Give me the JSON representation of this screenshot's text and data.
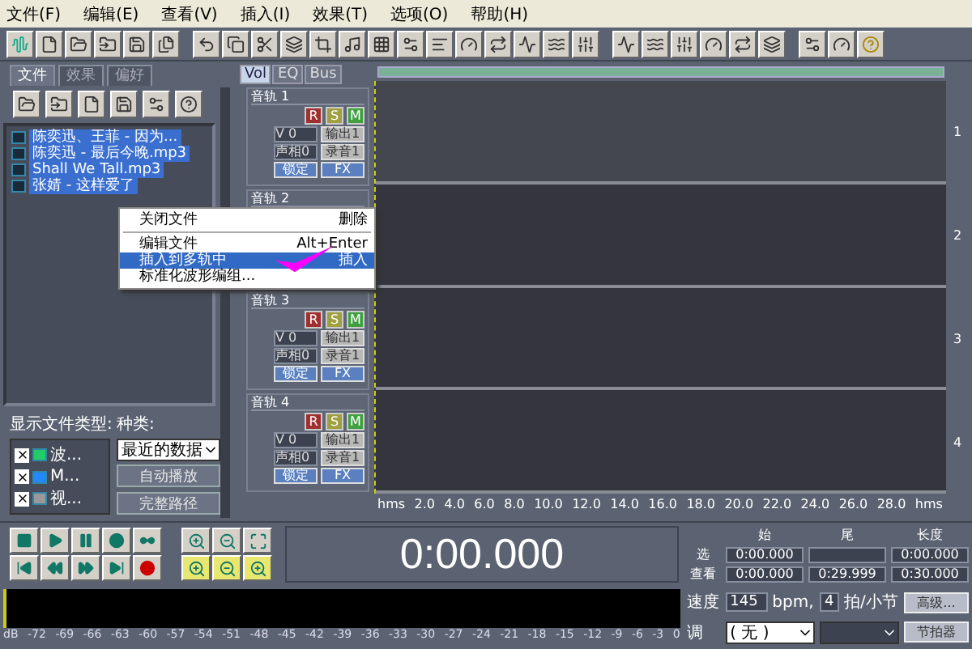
{
  "menu": [
    "文件(F)",
    "编辑(E)",
    "查看(V)",
    "插入(I)",
    "效果(T)",
    "选项(O)",
    "帮助(H)"
  ],
  "left_panel": {
    "tabs": [
      {
        "label": "文件",
        "selected": true
      },
      {
        "label": "效果",
        "selected": false
      },
      {
        "label": "偏好",
        "selected": false
      }
    ],
    "files": [
      {
        "name": "陈奕迅、王菲 - 因为...",
        "selected": true
      },
      {
        "name": "陈奕迅 - 最后今晚.mp3",
        "selected": true
      },
      {
        "name": "Shall We Tall.mp3",
        "selected": true
      },
      {
        "name": "张婧 - 这样爱了",
        "selected": true
      }
    ],
    "filter_label": "显示文件类型:",
    "sort_label": "种类:",
    "file_types": [
      {
        "label": "波...",
        "checked": true,
        "kind": "wave"
      },
      {
        "label": "M...",
        "checked": true,
        "kind": "midi"
      },
      {
        "label": "视...",
        "checked": true,
        "kind": "video"
      }
    ],
    "sort_select": "最近的数据",
    "buttons": [
      "自动播放",
      "完整路径"
    ]
  },
  "mixer_tabs": [
    {
      "label": "Vol",
      "selected": true
    },
    {
      "label": "EQ",
      "selected": false
    },
    {
      "label": "Bus",
      "selected": false
    }
  ],
  "tracks": [
    {
      "name": "音轨 1",
      "rsm": [
        "R",
        "S",
        "M"
      ],
      "volume": "V 0",
      "output": "输出1",
      "pan": "声相0",
      "input": "录音1",
      "lock": "锁定",
      "fx": "FX"
    },
    {
      "name": "音轨 2"
    },
    {
      "name": "音轨 3",
      "rsm": [
        "R",
        "S",
        "M"
      ],
      "volume": "V 0",
      "output": "输出1",
      "pan": "声相0",
      "input": "录音1",
      "lock": "锁定",
      "fx": "FX"
    },
    {
      "name": "音轨 4",
      "rsm": [
        "R",
        "S",
        "M"
      ],
      "volume": "V 0",
      "output": "输出1",
      "pan": "声相0",
      "input": "录音1",
      "lock": "锁定",
      "fx": "FX"
    }
  ],
  "lane_numbers": [
    "1",
    "2",
    "3",
    "4"
  ],
  "ruler": [
    "hms",
    "2.0",
    "4.0",
    "6.0",
    "8.0",
    "10.0",
    "12.0",
    "14.0",
    "16.0",
    "18.0",
    "20.0",
    "22.0",
    "24.0",
    "26.0",
    "28.0",
    "hms"
  ],
  "context_menu": [
    {
      "kind": "item",
      "label": "关闭文件",
      "shortcut": "删除",
      "selected": false
    },
    {
      "kind": "separator"
    },
    {
      "kind": "item",
      "label": "编辑文件",
      "shortcut": "Alt+Enter",
      "selected": false
    },
    {
      "kind": "item",
      "label": "插入到多轨中",
      "shortcut": "插入",
      "selected": true
    },
    {
      "kind": "item",
      "label": "标准化波形编组...",
      "selected": false
    }
  ],
  "time_display": "0:00.000",
  "selection": {
    "headers": [
      "始",
      "尾",
      "长度"
    ],
    "rows": [
      {
        "label": "选",
        "start": "0:00.000",
        "length": "0:00.000"
      },
      {
        "label": "查看",
        "start": "0:00.000",
        "end": "0:29.999",
        "length": "0:30.000"
      }
    ]
  },
  "meter_labels": [
    "dB",
    "-72",
    "-69",
    "-66",
    "-63",
    "-60",
    "-57",
    "-54",
    "-51",
    "-48",
    "-45",
    "-42",
    "-39",
    "-36",
    "-33",
    "-30",
    "-27",
    "-24",
    "-21",
    "-18",
    "-15",
    "-12",
    "-9",
    "-6",
    "-3",
    "0"
  ],
  "tempo": {
    "speed_label": "速度",
    "bpm": "145",
    "bpm_unit": "bpm,",
    "beats": "4",
    "beats_unit": "拍/小节",
    "advanced": "高级...",
    "key_label": "调",
    "key": "( 无 )",
    "metronome": "节拍器"
  }
}
